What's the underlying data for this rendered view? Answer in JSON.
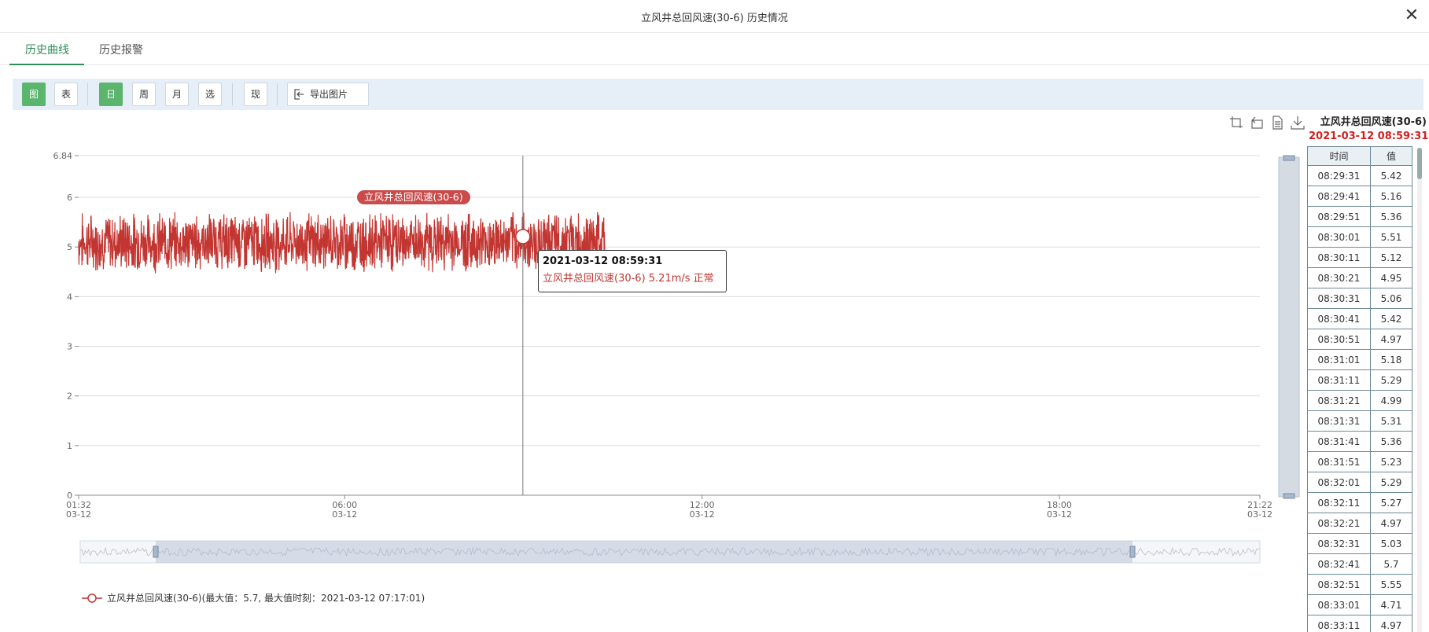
{
  "window": {
    "title": "立风井总回风速(30-6) 历史情况",
    "close_glyph": "✕"
  },
  "tabs": [
    {
      "label": "历史曲线",
      "active": true
    },
    {
      "label": "历史报警",
      "active": false
    }
  ],
  "toolbar": {
    "view_chart": "图",
    "view_table": "表",
    "range_day": "日",
    "range_week": "周",
    "range_month": "月",
    "range_select": "选",
    "now": "现",
    "export_label": "导出图片"
  },
  "colors": {
    "accent": "#5bb56c",
    "series": "#c23531",
    "tab_active": "#2e8b57",
    "alarm_date": "#d42020"
  },
  "chart_data": {
    "type": "line",
    "series": [
      {
        "name": "立风井总回风速(30-6)",
        "mean": 5.1,
        "min_shown": 4.3,
        "max": 5.7,
        "max_time": "2021-03-12 07:17:01",
        "x_start": "01:32",
        "x_end": "10:23"
      }
    ],
    "y_ticks": [
      "0",
      "1",
      "2",
      "3",
      "4",
      "5",
      "6",
      "6.84"
    ],
    "ylim": [
      0,
      6.84
    ],
    "x_ticks": [
      {
        "time": "01:32",
        "date": "03-12"
      },
      {
        "time": "06:00",
        "date": "03-12"
      },
      {
        "time": "12:00",
        "date": "03-12"
      },
      {
        "time": "18:00",
        "date": "03-12"
      },
      {
        "time": "21:22",
        "date": "03-12"
      }
    ],
    "xlim": [
      "01:32",
      "21:22"
    ],
    "cursor_time": "08:59:31",
    "cursor_value": 5.21,
    "grid": true,
    "legend": "bottom-left"
  },
  "tooltip": {
    "time": "2021-03-12 08:59:31",
    "text": "立风井总回风速(30-6) 5.21m/s 正常"
  },
  "series_tag": "立风井总回风速(30-6)",
  "legend": {
    "text": "立风井总回风速(30-6)(最大值：5.7, 最大值时刻：2021-03-12 07:17:01)"
  },
  "right_panel": {
    "title": "立风井总回风速(30-6)",
    "date": "2021-03-12 08:59:31",
    "col_time": "时间",
    "col_value": "值",
    "rows": [
      [
        "08:29:31",
        "5.42"
      ],
      [
        "08:29:41",
        "5.16"
      ],
      [
        "08:29:51",
        "5.36"
      ],
      [
        "08:30:01",
        "5.51"
      ],
      [
        "08:30:11",
        "5.12"
      ],
      [
        "08:30:21",
        "4.95"
      ],
      [
        "08:30:31",
        "5.06"
      ],
      [
        "08:30:41",
        "5.42"
      ],
      [
        "08:30:51",
        "4.97"
      ],
      [
        "08:31:01",
        "5.18"
      ],
      [
        "08:31:11",
        "5.29"
      ],
      [
        "08:31:21",
        "4.99"
      ],
      [
        "08:31:31",
        "5.31"
      ],
      [
        "08:31:41",
        "5.36"
      ],
      [
        "08:31:51",
        "5.23"
      ],
      [
        "08:32:01",
        "5.29"
      ],
      [
        "08:32:11",
        "5.27"
      ],
      [
        "08:32:21",
        "4.97"
      ],
      [
        "08:32:31",
        "5.03"
      ],
      [
        "08:32:41",
        "5.7"
      ],
      [
        "08:32:51",
        "5.55"
      ],
      [
        "08:33:01",
        "4.71"
      ],
      [
        "08:33:11",
        "4.97"
      ]
    ]
  }
}
